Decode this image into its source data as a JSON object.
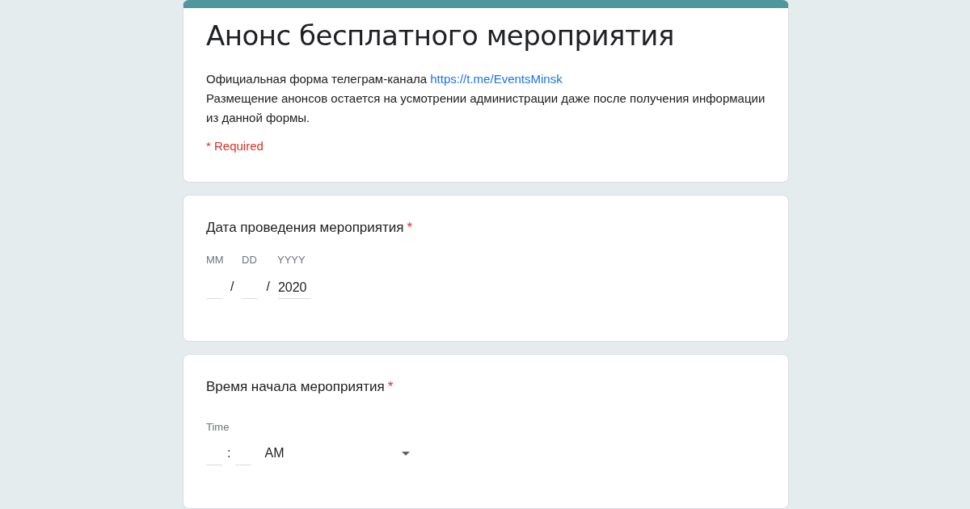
{
  "header": {
    "title": "Анонс бесплатного мероприятия",
    "description_prefix": "Официальная форма телеграм-канала",
    "link": "https://t.me/EventsMinsk",
    "description_rest": "Размещение анонсов остается на усмотрении администрации даже после получения информации из данной формы.",
    "required_note": "* Required"
  },
  "questions": [
    {
      "kind": "date",
      "title": "Дата проведения мероприятия",
      "required_mark": "*",
      "parts": [
        {
          "label": "MM",
          "separator": "/"
        },
        {
          "label": "DD",
          "separator": "/"
        },
        {
          "label": "YYYY",
          "value": "2020"
        }
      ]
    },
    {
      "kind": "time",
      "title": "Время начала мероприятия",
      "required_mark": "*",
      "label": "Time",
      "separator": ":",
      "period": "AM"
    }
  ]
}
